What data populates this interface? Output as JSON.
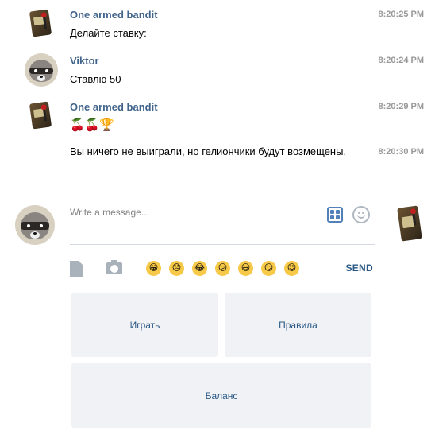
{
  "messages": [
    {
      "sender": "One armed bandit",
      "time": "8:20:25 PM",
      "text": "Делайте ставку:"
    },
    {
      "sender": "Viktor",
      "time": "8:20:24 PM",
      "text": "Ставлю 50"
    },
    {
      "sender": "One armed bandit",
      "time": "8:20:29 PM",
      "text": "🍒🍒🏆"
    },
    {
      "sender": "",
      "time": "8:20:30 PM",
      "text": "Вы ничего не выиграли, но гелиончики будут возмещены."
    }
  ],
  "composer": {
    "placeholder": "Write a message...",
    "send_label": "SEND",
    "emojis": [
      "😁",
      "😞",
      "😂",
      "😕",
      "😃",
      "😏",
      "😍"
    ]
  },
  "keyboard": {
    "buttons": [
      "Играть",
      "Правила",
      "Баланс"
    ]
  },
  "colors": {
    "sender_name": "#42648b",
    "accent": "#2a5885",
    "button_bg": "#f0f2f5"
  }
}
